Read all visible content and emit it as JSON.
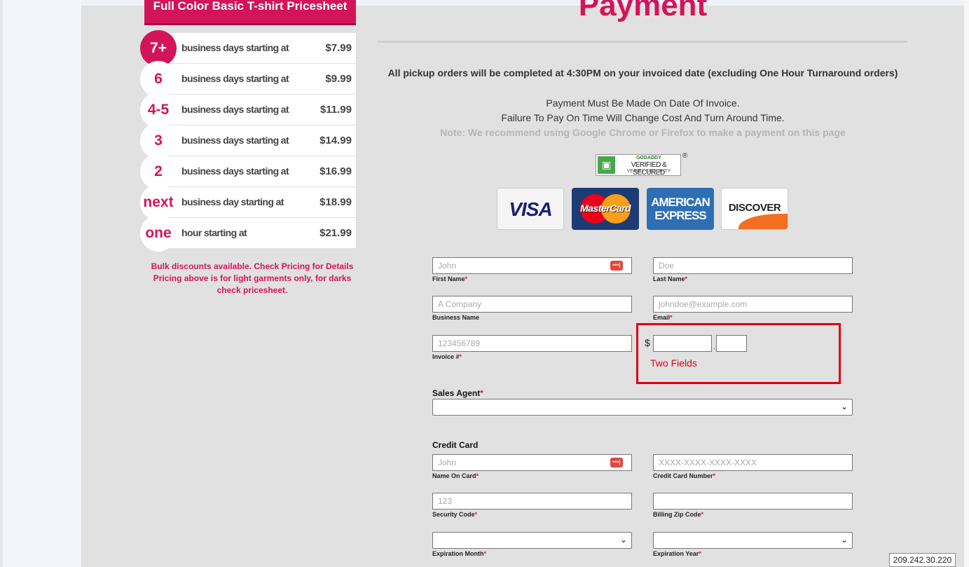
{
  "pricesheet": {
    "banner": "Full Color Basic T-shirt Pricesheet",
    "rows": [
      {
        "badge": "7+",
        "text": "business days starting at",
        "price": "$7.99"
      },
      {
        "badge": "6",
        "text": "business days starting at",
        "price": "$9.99"
      },
      {
        "badge": "4-5",
        "text": "business days starting at",
        "price": "$11.99"
      },
      {
        "badge": "3",
        "text": "business days starting at",
        "price": "$14.99"
      },
      {
        "badge": "2",
        "text": "business days starting at",
        "price": "$16.99"
      },
      {
        "badge": "next",
        "text": "business day starting at",
        "price": "$18.99"
      },
      {
        "badge": "one",
        "text": "hour starting at",
        "price": "$21.99"
      }
    ],
    "note_line1": "Bulk discounts available. Check Pricing for Details",
    "note_line2": "Pricing above is for light garments only, for darks check pricesheet."
  },
  "payment": {
    "title": "Payment",
    "pickup": "All pickup orders will be completed at 4:30PM on your invoiced date (excluding One Hour Turnaround orders)",
    "msg1": "Payment Must Be Made On Date Of Invoice.",
    "msg2": "Failure To Pay On Time Will Change Cost And Turn Around Time.",
    "note": "Note: We recommend using Google Chrome or Firefox to make a payment on this page",
    "godaddy": {
      "line1": "GODADDY",
      "line2": "VERIFIED & SECURED",
      "line3": "VERIFY SECURITY",
      "reg": "®"
    },
    "cards": {
      "visa": "VISA",
      "mastercard": "MasterCard",
      "amex": "AMERICAN EXPRESS",
      "discover": "DISCOVER"
    }
  },
  "form": {
    "first_name": {
      "placeholder": "John",
      "label": "First Name",
      "req": "*"
    },
    "last_name": {
      "placeholder": "Doe",
      "label": "Last Name",
      "req": "*"
    },
    "business": {
      "placeholder": "A Company",
      "label": "Business Name"
    },
    "email": {
      "placeholder": "johndoe@example.com",
      "label": "Email",
      "req": "*"
    },
    "invoice": {
      "placeholder": "123456789",
      "label": "Invoice #",
      "req": "*"
    },
    "amount": {
      "currency": "$",
      "separator": ".",
      "annotation": "Two Fields"
    },
    "sales_agent": {
      "label": "Sales Agent",
      "req": "*",
      "value": ""
    },
    "credit_card_heading": "Credit Card",
    "name_on_card": {
      "placeholder": "John",
      "label": "Name On Card",
      "req": "*"
    },
    "card_number": {
      "placeholder": "XXXX-XXXX-XXXX-XXXX",
      "label": "Credit Card Number",
      "req": "*"
    },
    "security_code": {
      "placeholder": "123",
      "label": "Security Code",
      "req": "*"
    },
    "zip": {
      "placeholder": "",
      "label": "Billing Zip Code",
      "req": "*"
    },
    "exp_month": {
      "label": "Expiration Month",
      "req": "*",
      "value": ""
    },
    "exp_year": {
      "label": "Expiration Year",
      "req": "*",
      "value": ""
    },
    "password_icon": "•••|"
  },
  "ip_address": "209.242.30.220",
  "colors": {
    "brand": "#d4145a",
    "annotation": "#e00010"
  },
  "icons": {
    "password_manager": "key-icon",
    "chevron": "chevron-down-icon",
    "lock": "lock-icon"
  }
}
